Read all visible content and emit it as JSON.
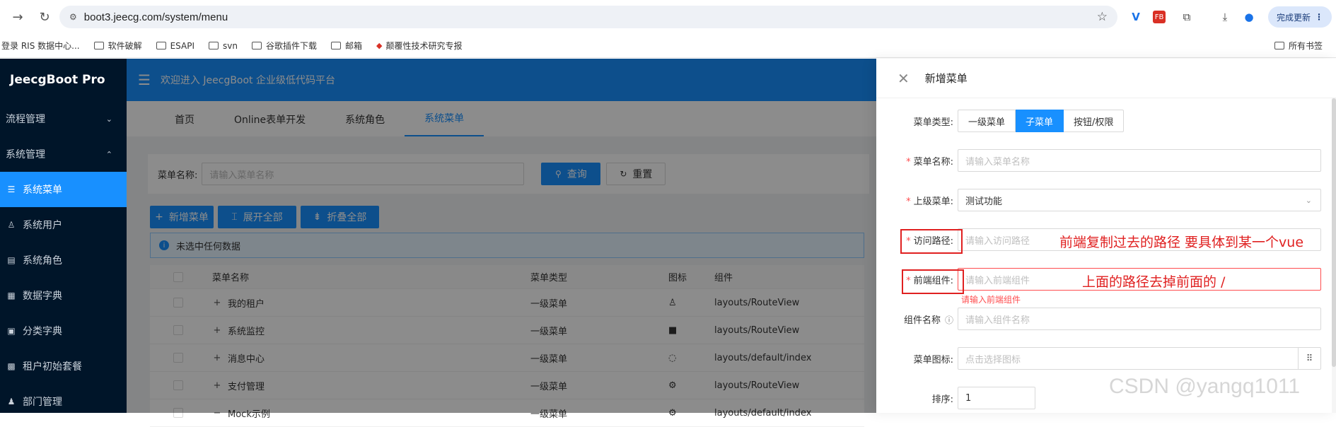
{
  "browser": {
    "url": "boot3.jeecg.com/system/menu",
    "update_label": "完成更新",
    "bookmarks": [
      "登录 RIS 数据中心...",
      "软件破解",
      "ESAPI",
      "svn",
      "谷歌插件下载",
      "邮箱",
      "颠覆性技术研究专报"
    ],
    "all_bookmarks": "所有书签"
  },
  "sidebar": {
    "logo": "JeecgBoot Pro",
    "items": [
      {
        "label": "流程管理",
        "arrow": "⌄"
      },
      {
        "label": "系统管理",
        "arrow": "⌃"
      },
      {
        "label": "系统菜单"
      },
      {
        "label": "系统用户"
      },
      {
        "label": "系统角色"
      },
      {
        "label": "数据字典"
      },
      {
        "label": "分类字典"
      },
      {
        "label": "租户初始套餐"
      },
      {
        "label": "部门管理"
      }
    ]
  },
  "header": {
    "welcome": "欢迎进入 JeecgBoot 企业级低代码平台"
  },
  "tabs": [
    "首页",
    "Online表单开发",
    "系统角色",
    "系统菜单"
  ],
  "search": {
    "label": "菜单名称:",
    "placeholder": "请输入菜单名称",
    "query": "查询",
    "reset": "重置"
  },
  "toolbar": {
    "add": "新增菜单",
    "expand": "展开全部",
    "collapse": "折叠全部"
  },
  "alert": "未选中任何数据",
  "table": {
    "headers": [
      "菜单名称",
      "菜单类型",
      "图标",
      "组件"
    ],
    "rows": [
      {
        "name": "我的租户",
        "type": "一级菜单",
        "comp": "layouts/RouteView"
      },
      {
        "name": "系统监控",
        "type": "一级菜单",
        "comp": "layouts/RouteView"
      },
      {
        "name": "消息中心",
        "type": "一级菜单",
        "comp": "layouts/default/index"
      },
      {
        "name": "支付管理",
        "type": "一级菜单",
        "comp": "layouts/RouteView"
      },
      {
        "name": "Mock示例",
        "type": "一级菜单",
        "comp": "layouts/default/index"
      }
    ]
  },
  "drawer": {
    "title": "新增菜单",
    "menu_type_label": "菜单类型:",
    "menu_types": [
      "一级菜单",
      "子菜单",
      "按钮/权限"
    ],
    "name_label": "菜单名称:",
    "name_placeholder": "请输入菜单名称",
    "parent_label": "上级菜单:",
    "parent_value": "测试功能",
    "path_label": "访问路径:",
    "path_placeholder": "请输入访问路径",
    "component_label": "前端组件:",
    "component_placeholder": "请输入前端组件",
    "component_error": "请输入前端组件",
    "component_name_label": "组件名称",
    "component_name_placeholder": "请输入组件名称",
    "icon_label": "菜单图标:",
    "icon_placeholder": "点击选择图标",
    "sort_label": "排序:",
    "sort_value": "1"
  },
  "annotations": {
    "path_note": "前端复制过去的路径 要具体到某一个vue",
    "component_note": "上面的路径去掉前面的 /"
  },
  "watermark": "CSDN @yangq1011",
  "colors": {
    "primary": "#1890ff",
    "sidebar": "#001529",
    "annotation": "#e02020"
  }
}
